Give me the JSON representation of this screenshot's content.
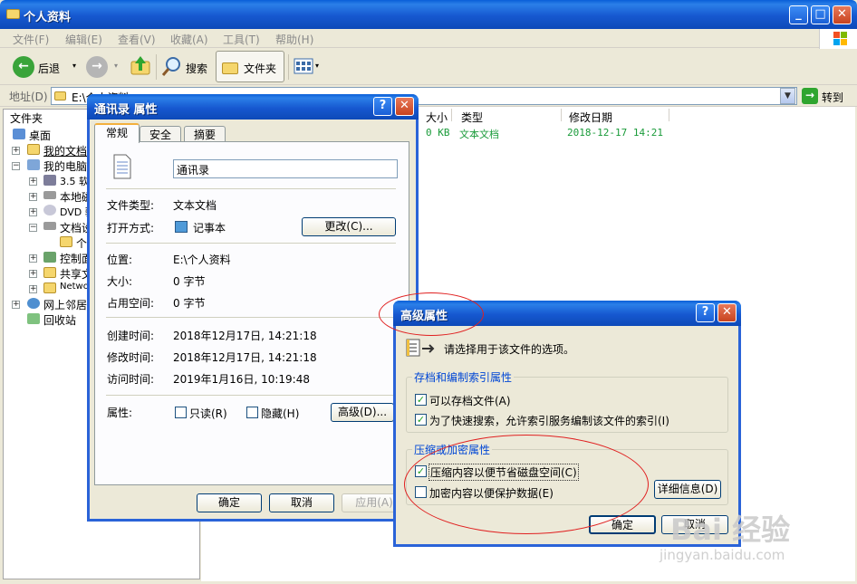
{
  "window": {
    "title": "个人资料"
  },
  "menu": [
    "文件(F)",
    "编辑(E)",
    "查看(V)",
    "收藏(A)",
    "工具(T)",
    "帮助(H)"
  ],
  "toolbar": {
    "back": "后退",
    "search": "搜索",
    "folders": "文件夹"
  },
  "address": {
    "label": "地址(D)",
    "value": "E:\\个人资料",
    "go": "转到"
  },
  "folders_pane": {
    "title": "文件夹",
    "items": [
      "桌面",
      "我的文档",
      "我的电脑",
      "3.5 软",
      "本地磁",
      "DVD 驱",
      "文档设",
      "个",
      "控制面",
      "共享文",
      "Netwo",
      "网上邻居",
      "回收站"
    ]
  },
  "file_list": {
    "columns": [
      "大小",
      "类型",
      "修改日期"
    ],
    "rows": [
      {
        "size": "0 KB",
        "type": "文本文档",
        "modified": "2018-12-17 14:21"
      }
    ]
  },
  "props_dialog": {
    "title": "通讯录 属性",
    "tabs": [
      "常规",
      "安全",
      "摘要"
    ],
    "file_name": "通讯录",
    "type_label": "文件类型:",
    "type_value": "文本文档",
    "open_label": "打开方式:",
    "open_value": "记事本",
    "change_btn": "更改(C)...",
    "location_label": "位置:",
    "location_value": "E:\\个人资料",
    "size_label": "大小:",
    "size_value": "0 字节",
    "disk_label": "占用空间:",
    "disk_value": "0 字节",
    "created_label": "创建时间:",
    "created_value": "2018年12月17日, 14:21:18",
    "modified_label": "修改时间:",
    "modified_value": "2018年12月17日, 14:21:18",
    "accessed_label": "访问时间:",
    "accessed_value": "2019年1月16日, 10:19:48",
    "attr_label": "属性:",
    "readonly": "只读(R)",
    "hidden": "隐藏(H)",
    "advanced_btn": "高级(D)...",
    "ok": "确定",
    "cancel": "取消",
    "apply": "应用(A)"
  },
  "adv_dialog": {
    "title": "高级属性",
    "intro": "请选择用于该文件的选项。",
    "group1": "存档和编制索引属性",
    "archive": "可以存档文件(A)",
    "index": "为了快速搜索，允许索引服务编制该文件的索引(I)",
    "group2": "压缩或加密属性",
    "compress": "压缩内容以便节省磁盘空间(C)",
    "encrypt": "加密内容以便保护数据(E)",
    "details_btn": "详细信息(D)",
    "ok": "确定",
    "cancel": "取消",
    "archive_checked": true,
    "index_checked": true,
    "compress_checked": true,
    "encrypt_checked": false
  },
  "watermark": {
    "brand": "Bai 经验",
    "url": "jingyan.baidu.com"
  },
  "colors": {
    "title_blue": "#1658d0",
    "file_text_green": "#1a9b3a",
    "annotation_red": "#e02020"
  }
}
